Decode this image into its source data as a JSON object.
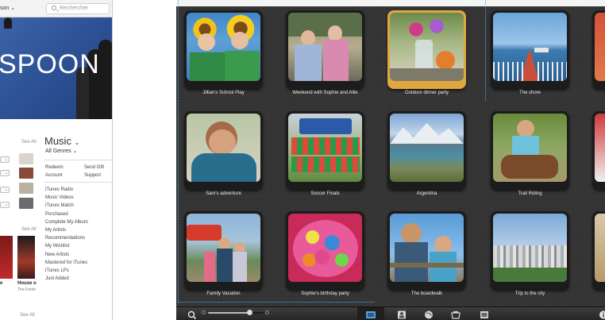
{
  "itunes": {
    "crumb": "son",
    "search_placeholder": "Rechercher",
    "banner_title": "SPOON",
    "see_all_1": "See All",
    "see_all_2": "See All",
    "see_all_3": "See All",
    "music_title": "Music",
    "genres": "All Genres",
    "links": [
      {
        "left": "Redeem",
        "right": "Send Gift"
      },
      {
        "left": "Account",
        "right": "Support"
      }
    ],
    "list": [
      "iTunes Radio",
      "Music Videos",
      "iTunes Match",
      "Purchased",
      "Complete My Album",
      "My Artists",
      "Recommendations",
      "My Wishlist",
      "New Artists",
      "Mastered for iTunes",
      "iTunes LPs",
      "Just Added"
    ],
    "album_titles": {
      "first": "e",
      "second": "House o"
    },
    "album_sub": "The Fresh"
  },
  "iphoto": {
    "events": [
      {
        "label": "Jillian's School Play",
        "selected": false
      },
      {
        "label": "Weekend with Sophie and Allie",
        "selected": false
      },
      {
        "label": "Outdoor dinner party",
        "selected": true
      },
      {
        "label": "The shore",
        "selected": false
      },
      {
        "label": "Sam's adventure",
        "selected": false
      },
      {
        "label": "Soccer Finals",
        "selected": false
      },
      {
        "label": "Argentina",
        "selected": false
      },
      {
        "label": "Trail Riding",
        "selected": false
      },
      {
        "label": "Family Vacation",
        "selected": false
      },
      {
        "label": "Sophie's birthday party",
        "selected": false
      },
      {
        "label": "The boardwalk",
        "selected": false
      },
      {
        "label": "Trip to the city",
        "selected": false
      }
    ],
    "toolbar": {
      "icons": [
        "search-icon",
        "zoom-slider",
        "events-icon",
        "faces-icon",
        "places-icon",
        "projects-icon",
        "albums-icon",
        "info-icon"
      ],
      "selection_color": "#1f1f1f"
    },
    "colors": {
      "selected_frame": "#e0a640",
      "guide_line": "#4aa8e8",
      "grid_background": "#323232"
    }
  }
}
